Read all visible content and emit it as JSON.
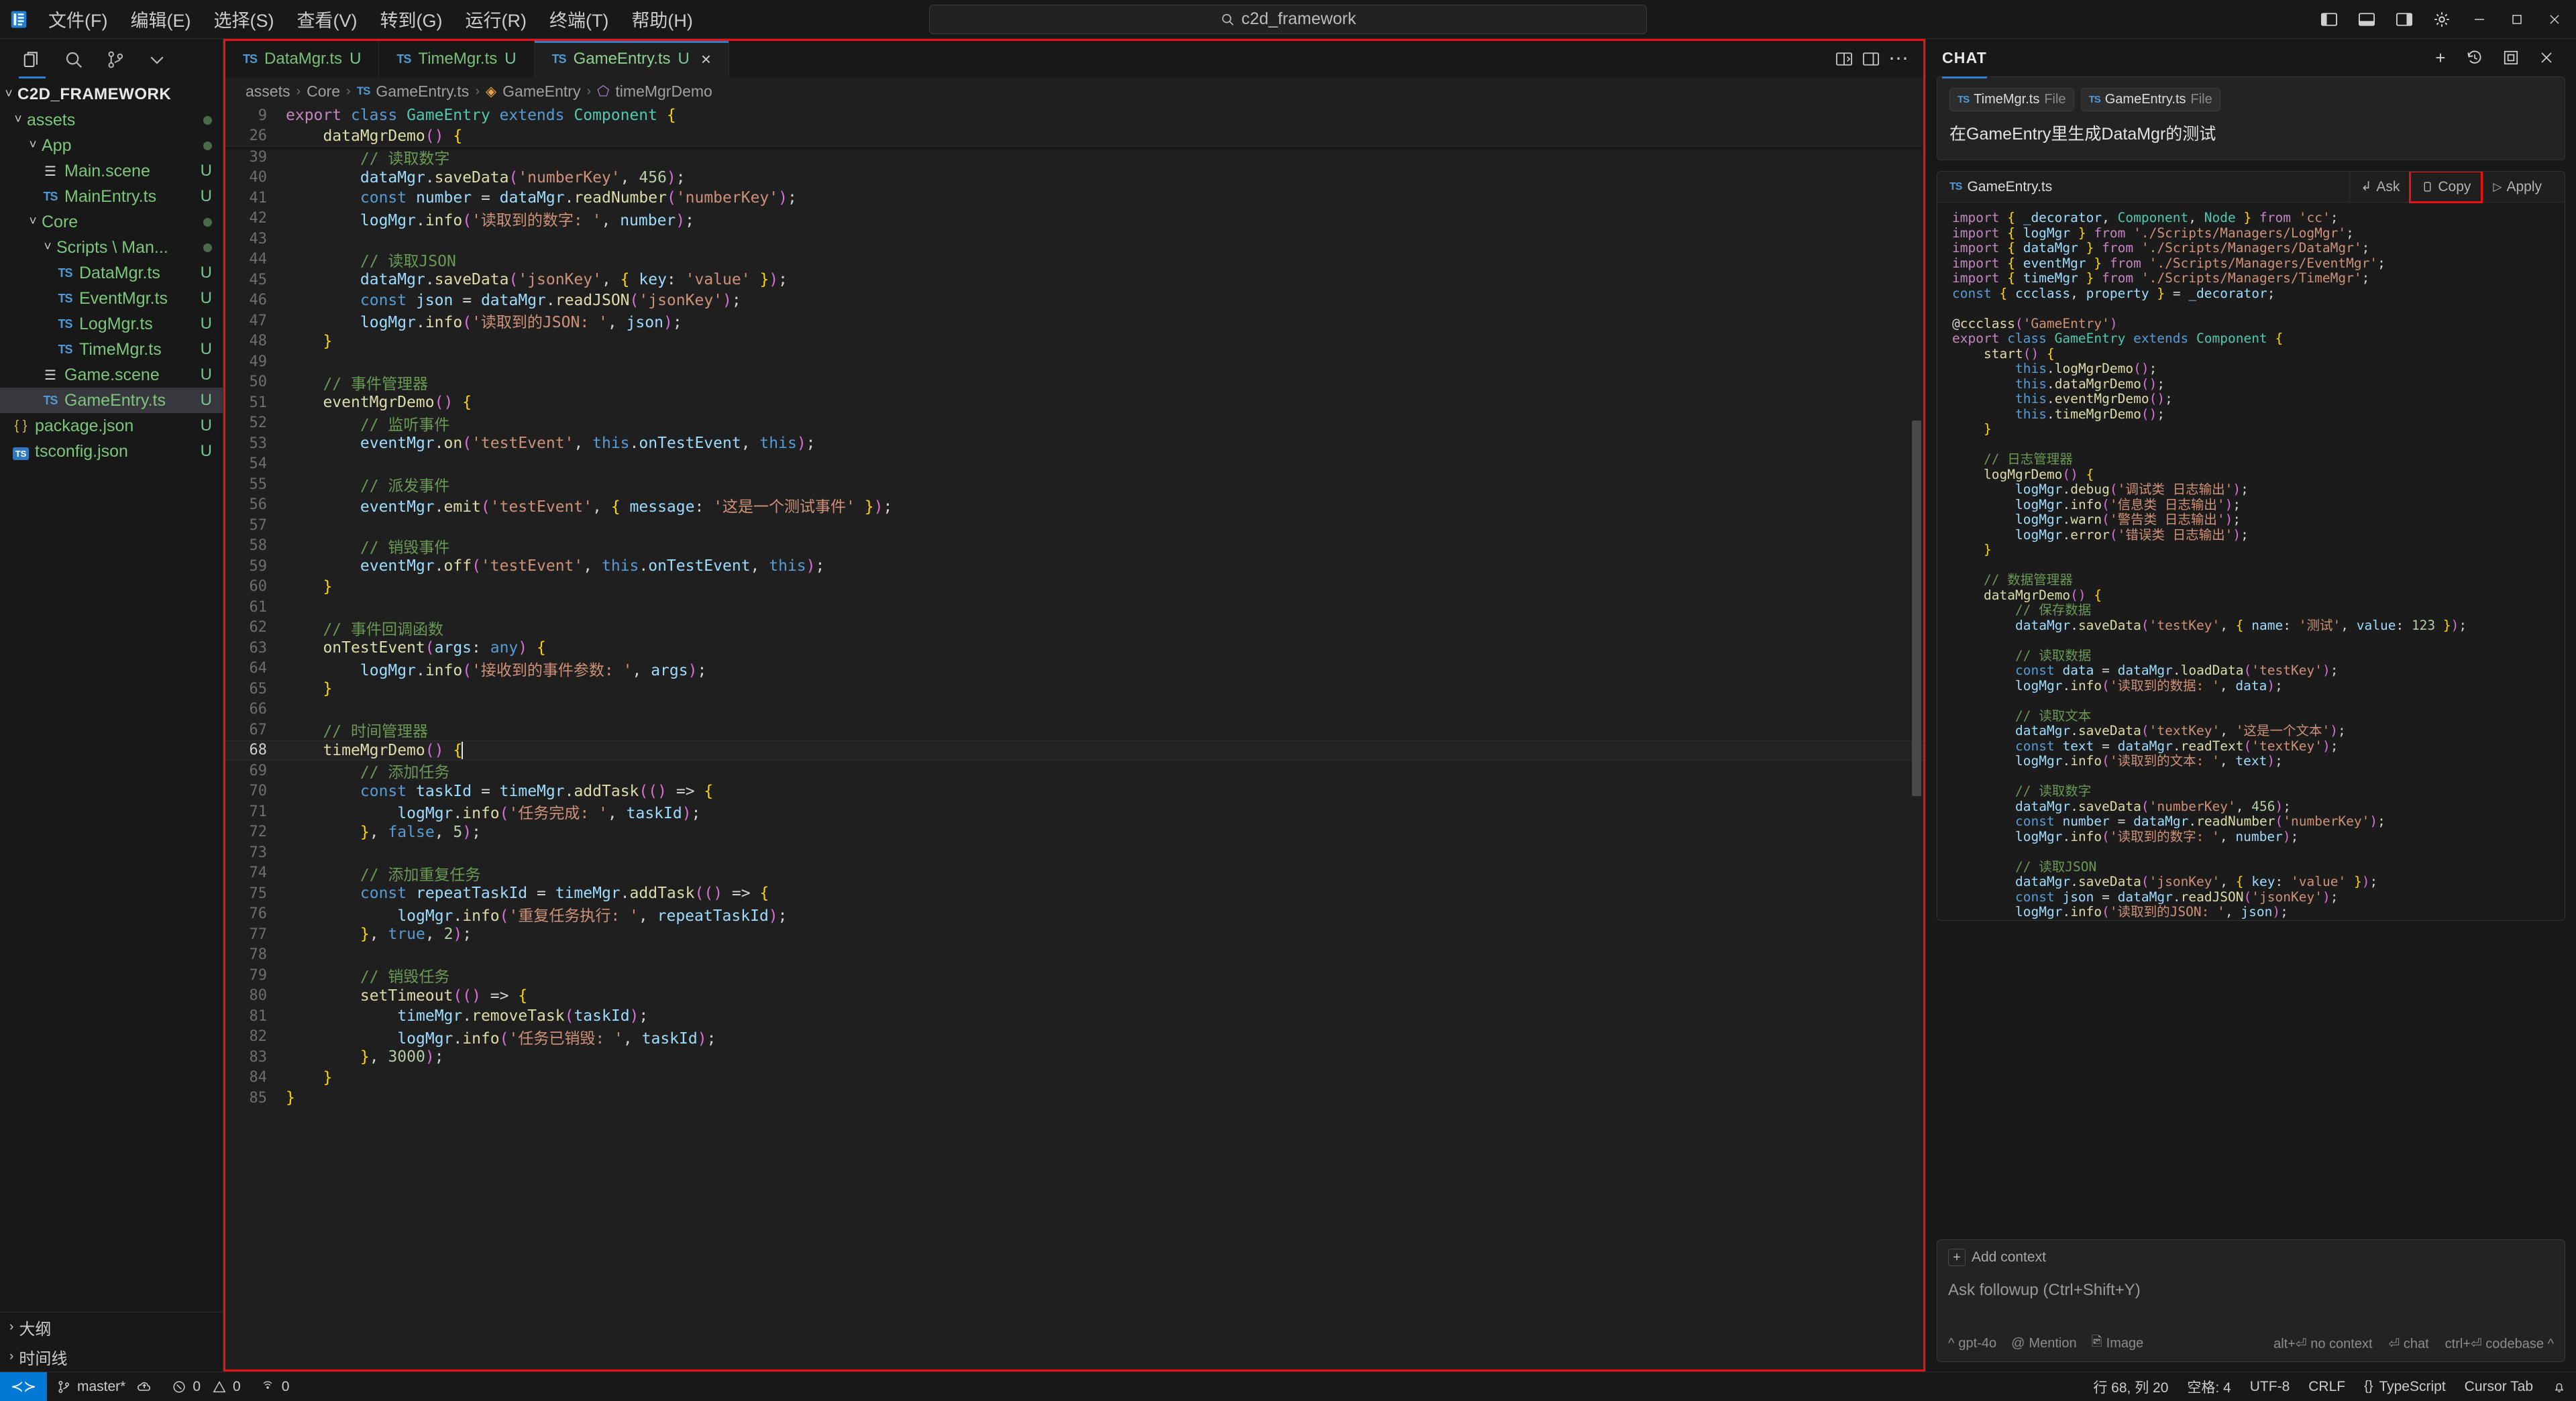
{
  "titlebar": {
    "menus": [
      "文件(F)",
      "编辑(E)",
      "选择(S)",
      "查看(V)",
      "转到(G)",
      "运行(R)",
      "终端(T)",
      "帮助(H)"
    ],
    "back_icon": "←",
    "forward_icon": "→",
    "search_value": "c2d_framework",
    "search_icon": "search-icon"
  },
  "sidebar": {
    "actions": [
      "explorer-icon",
      "search-icon",
      "source-control-icon",
      "chevron-down-icon"
    ],
    "root": "C2D_FRAMEWORK",
    "items": [
      {
        "label": "assets",
        "indent": 1,
        "kind": "folder",
        "badge": "dot",
        "expanded": true
      },
      {
        "label": "App",
        "indent": 2,
        "kind": "folder",
        "badge": "dot",
        "expanded": true
      },
      {
        "label": "Main.scene",
        "indent": 3,
        "kind": "scene",
        "badge": "U"
      },
      {
        "label": "MainEntry.ts",
        "indent": 3,
        "kind": "ts",
        "badge": "U"
      },
      {
        "label": "Core",
        "indent": 2,
        "kind": "folder",
        "badge": "dot",
        "expanded": true
      },
      {
        "label": "Scripts \\ Man...",
        "indent": 3,
        "kind": "folder",
        "badge": "dot",
        "expanded": true
      },
      {
        "label": "DataMgr.ts",
        "indent": 4,
        "kind": "ts",
        "badge": "U"
      },
      {
        "label": "EventMgr.ts",
        "indent": 4,
        "kind": "ts",
        "badge": "U"
      },
      {
        "label": "LogMgr.ts",
        "indent": 4,
        "kind": "ts",
        "badge": "U"
      },
      {
        "label": "TimeMgr.ts",
        "indent": 4,
        "kind": "ts",
        "badge": "U"
      },
      {
        "label": "Game.scene",
        "indent": 3,
        "kind": "scene",
        "badge": "U"
      },
      {
        "label": "GameEntry.ts",
        "indent": 3,
        "kind": "ts",
        "badge": "U",
        "selected": true
      },
      {
        "label": "package.json",
        "indent": 1,
        "kind": "json",
        "badge": "U"
      },
      {
        "label": "tsconfig.json",
        "indent": 1,
        "kind": "tsconfig",
        "badge": "U"
      }
    ],
    "sections": [
      {
        "label": "大纲",
        "icon": "chevron-right-icon"
      },
      {
        "label": "时间线",
        "icon": "chevron-right-icon"
      }
    ]
  },
  "editor": {
    "tabs": [
      {
        "name": "DataMgr.ts",
        "badge": "U",
        "active": false,
        "icon": "ts-icon"
      },
      {
        "name": "TimeMgr.ts",
        "badge": "U",
        "active": false,
        "icon": "ts-icon"
      },
      {
        "name": "GameEntry.ts",
        "badge": "U",
        "active": true,
        "icon": "ts-icon",
        "close": "×"
      }
    ],
    "tab_actions": [
      "split-editor-icon",
      "layout-icon",
      "more-actions-icon"
    ],
    "breadcrumb": [
      "assets",
      "Core",
      "GameEntry.ts",
      "GameEntry",
      "timeMgrDemo"
    ],
    "sticky": [
      {
        "no": "9",
        "text": "export class GameEntry extends Component {"
      },
      {
        "no": "26",
        "text": "    dataMgrDemo() {"
      }
    ],
    "lines": [
      {
        "no": "39",
        "text": "        // 读取数字"
      },
      {
        "no": "40",
        "text": "        dataMgr.saveData('numberKey', 456);"
      },
      {
        "no": "41",
        "text": "        const number = dataMgr.readNumber('numberKey');"
      },
      {
        "no": "42",
        "text": "        logMgr.info('读取到的数字: ', number);"
      },
      {
        "no": "43",
        "text": ""
      },
      {
        "no": "44",
        "text": "        // 读取JSON"
      },
      {
        "no": "45",
        "text": "        dataMgr.saveData('jsonKey', { key: 'value' });"
      },
      {
        "no": "46",
        "text": "        const json = dataMgr.readJSON('jsonKey');"
      },
      {
        "no": "47",
        "text": "        logMgr.info('读取到的JSON: ', json);"
      },
      {
        "no": "48",
        "text": "    }"
      },
      {
        "no": "49",
        "text": ""
      },
      {
        "no": "50",
        "text": "    // 事件管理器"
      },
      {
        "no": "51",
        "text": "    eventMgrDemo() {"
      },
      {
        "no": "52",
        "text": "        // 监听事件"
      },
      {
        "no": "53",
        "text": "        eventMgr.on('testEvent', this.onTestEvent, this);"
      },
      {
        "no": "54",
        "text": ""
      },
      {
        "no": "55",
        "text": "        // 派发事件"
      },
      {
        "no": "56",
        "text": "        eventMgr.emit('testEvent', { message: '这是一个测试事件' });"
      },
      {
        "no": "57",
        "text": ""
      },
      {
        "no": "58",
        "text": "        // 销毁事件"
      },
      {
        "no": "59",
        "text": "        eventMgr.off('testEvent', this.onTestEvent, this);"
      },
      {
        "no": "60",
        "text": "    }"
      },
      {
        "no": "61",
        "text": ""
      },
      {
        "no": "62",
        "text": "    // 事件回调函数"
      },
      {
        "no": "63",
        "text": "    onTestEvent(args: any) {"
      },
      {
        "no": "64",
        "text": "        logMgr.info('接收到的事件参数: ', args);"
      },
      {
        "no": "65",
        "text": "    }"
      },
      {
        "no": "66",
        "text": ""
      },
      {
        "no": "67",
        "text": "    // 时间管理器"
      },
      {
        "no": "68",
        "text": "    timeMgrDemo() {",
        "current": true
      },
      {
        "no": "69",
        "text": "        // 添加任务"
      },
      {
        "no": "70",
        "text": "        const taskId = timeMgr.addTask(() => {"
      },
      {
        "no": "71",
        "text": "            logMgr.info('任务完成: ', taskId);"
      },
      {
        "no": "72",
        "text": "        }, false, 5);"
      },
      {
        "no": "73",
        "text": ""
      },
      {
        "no": "74",
        "text": "        // 添加重复任务"
      },
      {
        "no": "75",
        "text": "        const repeatTaskId = timeMgr.addTask(() => {"
      },
      {
        "no": "76",
        "text": "            logMgr.info('重复任务执行: ', repeatTaskId);"
      },
      {
        "no": "77",
        "text": "        }, true, 2);"
      },
      {
        "no": "78",
        "text": ""
      },
      {
        "no": "79",
        "text": "        // 销毁任务"
      },
      {
        "no": "80",
        "text": "        setTimeout(() => {"
      },
      {
        "no": "81",
        "text": "            timeMgr.removeTask(taskId);"
      },
      {
        "no": "82",
        "text": "            logMgr.info('任务已销毁: ', taskId);"
      },
      {
        "no": "83",
        "text": "        }, 3000);"
      },
      {
        "no": "84",
        "text": "    }"
      },
      {
        "no": "85",
        "text": "}"
      }
    ]
  },
  "chat": {
    "title": "CHAT",
    "header_icons": [
      "new-chat-icon",
      "history-icon",
      "open-in-editor-icon",
      "close-icon"
    ],
    "user_message": {
      "context_chips": [
        {
          "name": "TimeMgr.ts",
          "type": "File"
        },
        {
          "name": "GameEntry.ts",
          "type": "File"
        }
      ],
      "text": "在GameEntry里生成DataMgr的测试"
    },
    "code_card": {
      "filename": "GameEntry.ts",
      "actions": [
        {
          "label": "Ask",
          "icon": "ask-icon",
          "highlighted": false
        },
        {
          "label": "Copy",
          "icon": "copy-icon",
          "highlighted": true
        },
        {
          "label": "Apply",
          "icon": "play-icon",
          "highlighted": false
        }
      ],
      "lines": [
        "import { _decorator, Component, Node } from 'cc';",
        "import { logMgr } from './Scripts/Managers/LogMgr';",
        "import { dataMgr } from './Scripts/Managers/DataMgr';",
        "import { eventMgr } from './Scripts/Managers/EventMgr';",
        "import { timeMgr } from './Scripts/Managers/TimeMgr';",
        "const { ccclass, property } = _decorator;",
        "",
        "@ccclass('GameEntry')",
        "export class GameEntry extends Component {",
        "    start() {",
        "        this.logMgrDemo();",
        "        this.dataMgrDemo();",
        "        this.eventMgrDemo();",
        "        this.timeMgrDemo();",
        "    }",
        "",
        "    // 日志管理器",
        "    logMgrDemo() {",
        "        logMgr.debug('调试类 日志输出');",
        "        logMgr.info('信息类 日志输出');",
        "        logMgr.warn('警告类 日志输出');",
        "        logMgr.error('错误类 日志输出');",
        "    }",
        "",
        "    // 数据管理器",
        "    dataMgrDemo() {",
        "        // 保存数据",
        "        dataMgr.saveData('testKey', { name: '测试', value: 123 });",
        "",
        "        // 读取数据",
        "        const data = dataMgr.loadData('testKey');",
        "        logMgr.info('读取到的数据: ', data);",
        "",
        "        // 读取文本",
        "        dataMgr.saveData('textKey', '这是一个文本');",
        "        const text = dataMgr.readText('textKey');",
        "        logMgr.info('读取到的文本: ', text);",
        "",
        "        // 读取数字",
        "        dataMgr.saveData('numberKey', 456);",
        "        const number = dataMgr.readNumber('numberKey');",
        "        logMgr.info('读取到的数字: ', number);",
        "",
        "        // 读取JSON",
        "        dataMgr.saveData('jsonKey', { key: 'value' });",
        "        const json = dataMgr.readJSON('jsonKey');",
        "        logMgr.info('读取到的JSON: ', json);"
      ]
    },
    "input": {
      "add_context_label": "Add context",
      "add_context_icon": "plus-icon",
      "placeholder": "Ask followup (Ctrl+Shift+Y)",
      "model": "gpt-4o",
      "mention_label": "Mention",
      "image_label": "Image",
      "hint_no_context": "alt+⏎ no context",
      "hint_chat": "⏎ chat",
      "hint_codebase": "ctrl+⏎ codebase ^"
    }
  },
  "statusbar": {
    "remote_icon": "remote-window-icon",
    "branch": "master*",
    "sync_icon": "sync-icon",
    "errors": "0",
    "warnings": "0",
    "ports": "0",
    "line_col": "行 68, 列 20",
    "indent": "空格: 4",
    "encoding": "UTF-8",
    "eol": "CRLF",
    "language": "TypeScript",
    "cursor_tab": "Cursor Tab",
    "bell_icon": "bell-icon"
  },
  "colors": {
    "accent": "#2f7fd1",
    "remote": "#0078d4",
    "highlight_box": "#ee1111",
    "green_file": "#7cc67c"
  }
}
